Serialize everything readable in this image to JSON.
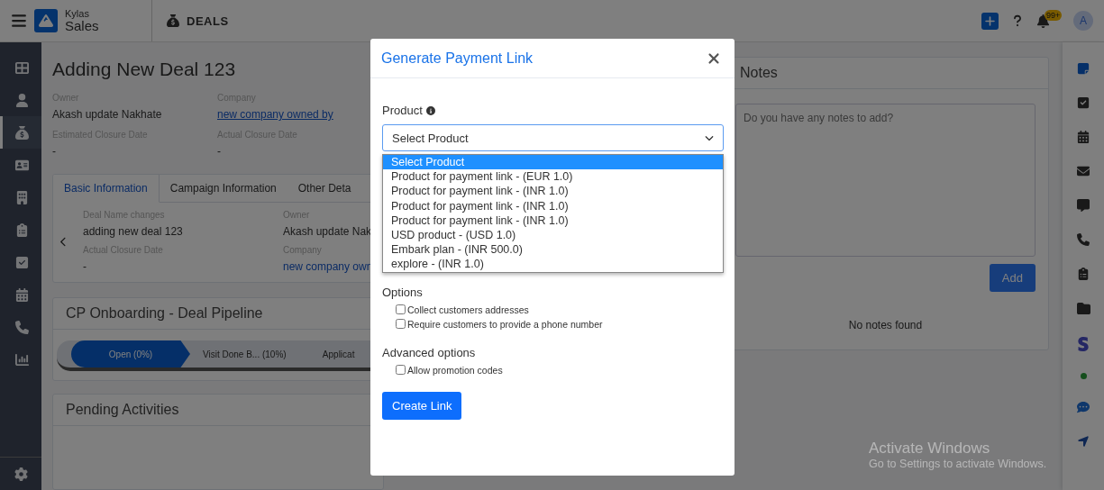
{
  "topbar": {
    "app_name": "Kylas",
    "product": "Sales",
    "module": "DEALS",
    "notification_badge": "99+",
    "avatar": "A"
  },
  "sidebar": {
    "items": [
      {
        "selected": false
      },
      {
        "selected": false
      },
      {
        "selected": true
      },
      {
        "selected": false
      },
      {
        "selected": false
      },
      {
        "selected": false
      },
      {
        "selected": false
      },
      {
        "selected": false
      },
      {
        "selected": false
      },
      {
        "selected": false
      }
    ]
  },
  "deal": {
    "title": "Adding New Deal 123",
    "fields": [
      {
        "label": "Owner",
        "value": "Akash update Nakhate",
        "kind": "text"
      },
      {
        "label": "Company",
        "value": "new company owned by",
        "kind": "link"
      },
      {
        "label": "Estimated Closure Date",
        "value": "-",
        "kind": "text"
      },
      {
        "label": "Actual Closure Date",
        "value": "-",
        "kind": "text"
      }
    ]
  },
  "info_tabs": {
    "tabs": [
      {
        "label": "Basic Information",
        "selected": true
      },
      {
        "label": "Campaign Information",
        "selected": false
      },
      {
        "label": "Other Deta",
        "selected": false
      }
    ],
    "fields": [
      {
        "label": "Deal Name changes",
        "value": "adding new deal 123",
        "kind": "text"
      },
      {
        "label": "Owner",
        "value": "Akash update Nak",
        "kind": "text"
      },
      {
        "label": "Actual Closure Date",
        "value": "-",
        "kind": "text"
      },
      {
        "label": "Company",
        "value": "new company own",
        "kind": "link"
      }
    ]
  },
  "pipeline": {
    "title": "CP Onboarding - Deal Pipeline",
    "stages": [
      {
        "label": "Open (0%)",
        "selected": true
      },
      {
        "label": "Visit Done B... (10%)",
        "selected": false
      },
      {
        "label": "Applicat",
        "selected": false
      }
    ]
  },
  "activities": {
    "title": "Pending Activities"
  },
  "notes": {
    "title": "Notes",
    "placeholder": "Do you have any notes to add?",
    "add_button": "Add",
    "empty": "No notes found"
  },
  "modal": {
    "title": "Generate Payment Link",
    "product_label": "Product",
    "select_value": "Select Product",
    "options": [
      {
        "label": "Select Product",
        "selected": true
      },
      {
        "label": "Product for payment link - (EUR 1.0)",
        "selected": false
      },
      {
        "label": "Product for payment link - (INR 1.0)",
        "selected": false
      },
      {
        "label": "Product for payment link - (INR 1.0)",
        "selected": false
      },
      {
        "label": "Product for payment link - (INR 1.0)",
        "selected": false
      },
      {
        "label": "USD product - (USD 1.0)",
        "selected": false
      },
      {
        "label": "Embark plan - (INR 500.0)",
        "selected": false
      },
      {
        "label": "explore - (INR 1.0)",
        "selected": false
      }
    ],
    "options_title": "Options",
    "checkboxes": [
      {
        "label": "Collect customers addresses",
        "checked": false
      },
      {
        "label": "Require customers to provide a phone number",
        "checked": false
      }
    ],
    "advanced_title": "Advanced options",
    "advanced_checkboxes": [
      {
        "label": "Allow promotion codes",
        "checked": false
      }
    ],
    "submit": "Create Link"
  },
  "os_notice": {
    "title": "Activate Windows",
    "subtitle": "Go to Settings to activate Windows."
  }
}
